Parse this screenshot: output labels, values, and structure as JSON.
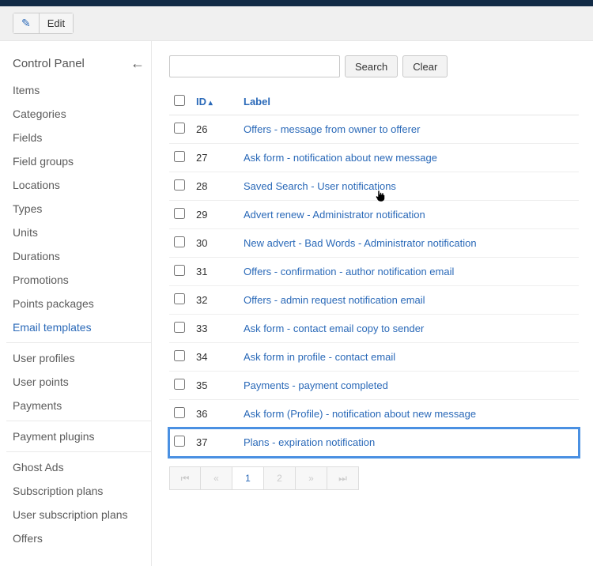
{
  "toolbar": {
    "edit_label": "Edit"
  },
  "sidebar": {
    "title": "Control Panel",
    "groups": [
      [
        "Items",
        "Categories",
        "Fields",
        "Field groups",
        "Locations",
        "Types",
        "Units",
        "Durations",
        "Promotions",
        "Points packages",
        "Email templates"
      ],
      [
        "User profiles",
        "User points",
        "Payments"
      ],
      [
        "Payment plugins"
      ],
      [
        "Ghost Ads",
        "Subscription plans",
        "User subscription plans",
        "Offers"
      ]
    ],
    "active": "Email templates"
  },
  "search": {
    "placeholder": "",
    "search_label": "Search",
    "clear_label": "Clear"
  },
  "table": {
    "columns": {
      "id": "ID",
      "label": "Label"
    },
    "rows": [
      {
        "id": 26,
        "label": "Offers - message from owner to offerer"
      },
      {
        "id": 27,
        "label": "Ask form - notification about new message"
      },
      {
        "id": 28,
        "label": "Saved Search - User notifications"
      },
      {
        "id": 29,
        "label": "Advert renew - Administrator notification"
      },
      {
        "id": 30,
        "label": "New advert - Bad Words - Administrator notification"
      },
      {
        "id": 31,
        "label": "Offers - confirmation - author notification email"
      },
      {
        "id": 32,
        "label": "Offers - admin request notification email"
      },
      {
        "id": 33,
        "label": "Ask form - contact email copy to sender"
      },
      {
        "id": 34,
        "label": "Ask form in profile - contact email"
      },
      {
        "id": 35,
        "label": "Payments - payment completed"
      },
      {
        "id": 36,
        "label": "Ask form (Profile) - notification about new message"
      },
      {
        "id": 37,
        "label": "Plans - expiration notification"
      }
    ],
    "highlight_id": 37,
    "cursor_row_id": 28
  },
  "pagination": {
    "pages": [
      "1",
      "2"
    ],
    "current": "1"
  }
}
